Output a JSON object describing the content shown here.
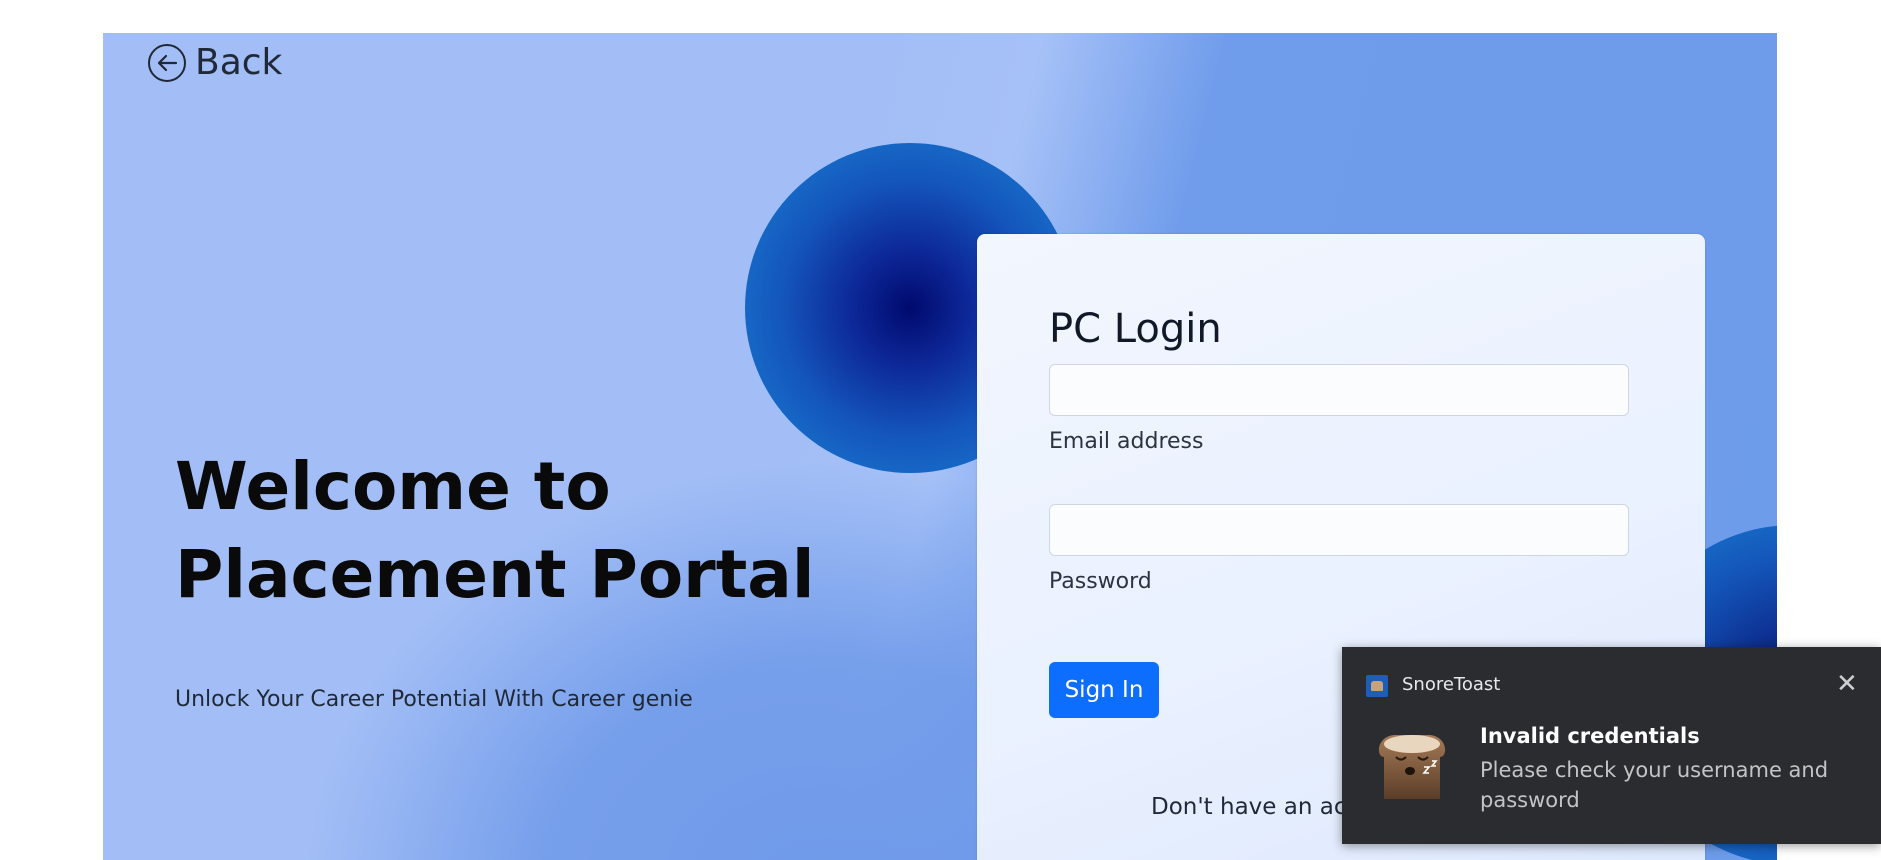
{
  "nav": {
    "back_label": "Back"
  },
  "hero": {
    "title": "Welcome to\nPlacement Portal",
    "tagline": "Unlock Your Career Potential With Career genie"
  },
  "login": {
    "title": "PC Login",
    "email_label": "Email address",
    "email_value": "",
    "password_label": "Password",
    "password_value": "",
    "signin_label": "Sign In",
    "signup_prompt": "Don't have an acco"
  },
  "toast": {
    "app_name": "SnoreToast",
    "close_glyph": "✕",
    "title": "Invalid credentials",
    "message": "Please check your username and password"
  },
  "colors": {
    "primary_button": "#0d6efd",
    "toast_background": "#2b2c30",
    "orb_core": "#000a6e"
  },
  "icons": [
    "back-arrow-icon",
    "snoretoast-app-icon",
    "close-icon",
    "sleeping-toast-icon"
  ]
}
